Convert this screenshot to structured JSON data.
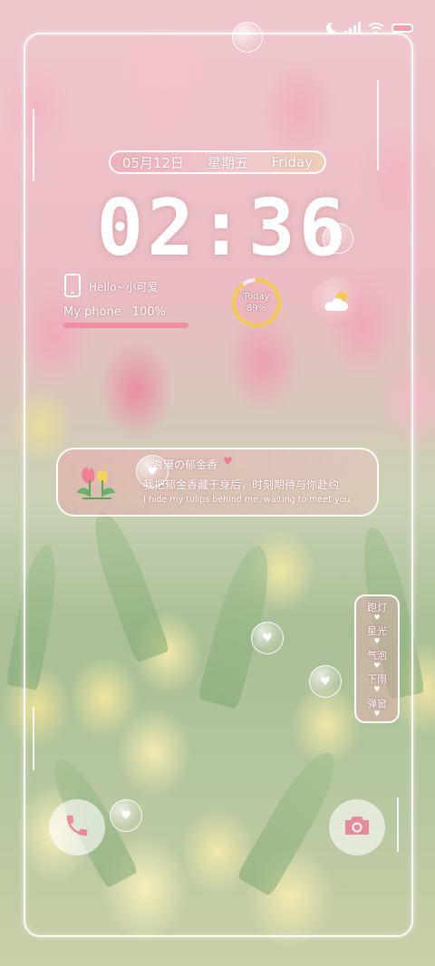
{
  "status_bar": {
    "icons": [
      "moon-icon",
      "signal-icon",
      "wifi-icon",
      "battery-icon"
    ]
  },
  "date": {
    "date_cn": "05月12日",
    "weekday_cn": "星期五",
    "weekday_en": "Friday"
  },
  "clock": {
    "time": "02:36"
  },
  "phone_widget": {
    "greeting": "Hello~小可爱",
    "label": "My phone",
    "battery_percent": "100%",
    "battery_fraction": 1.0
  },
  "today_widget": {
    "label": "Today",
    "percent": "89%",
    "fraction": 0.89,
    "ring_color": "#f2c94c"
  },
  "weather_widget": {
    "icon": "partly-cloudy-icon"
  },
  "message_card": {
    "title": "浪漫の郁金香",
    "line_cn": "我把郁金香藏于身后，时刻期待与你赴约",
    "line_en": "I hide my tulips behind me, waiting to meet you"
  },
  "effects_menu": {
    "items": [
      "跑灯",
      "星光",
      "气泡",
      "下雨",
      "弹窗"
    ]
  },
  "shortcuts": {
    "left": "phone-icon",
    "right": "camera-icon",
    "icon_color": "#e88a9a"
  }
}
